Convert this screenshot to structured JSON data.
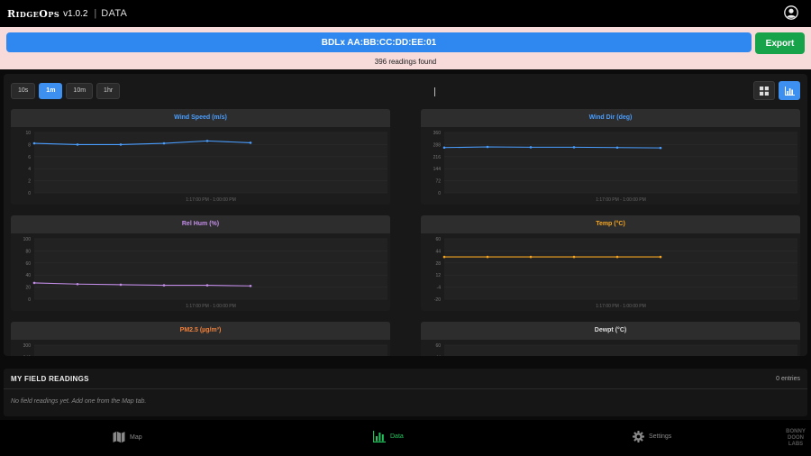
{
  "header": {
    "brand": "RidgeOps",
    "version": "v1.0.2",
    "separator": "|",
    "section": "DATA",
    "user_icon": "user-circle-icon"
  },
  "device": {
    "label": "BDLx AA:BB:CC:DD:EE:01",
    "export_label": "Export",
    "readings_found": "396 readings found"
  },
  "controls": {
    "ranges": [
      {
        "label": "10s",
        "active": false
      },
      {
        "label": "1m",
        "active": true
      },
      {
        "label": "10m",
        "active": false
      },
      {
        "label": "1hr",
        "active": false
      }
    ],
    "views": [
      {
        "icon": "grid-icon",
        "active": false
      },
      {
        "icon": "bar-chart-icon",
        "active": true
      }
    ]
  },
  "colors": {
    "accent": "#3d8ff0",
    "export": "#17a34a",
    "banner_bg": "#f7dada",
    "wind_speed": "#4a9eff",
    "wind_dir": "#4a9eff",
    "rel_hum": "#c38de8",
    "temp": "#f5a623",
    "pm25": "#f0803c",
    "dewpt": "#dddddd"
  },
  "charts": [
    {
      "title": "Wind Speed (m/s)",
      "color_key": "wind_speed",
      "ticks": [
        "10",
        "8",
        "6",
        "4",
        "2",
        "0"
      ],
      "ylim": [
        0,
        10
      ],
      "values": [
        8.2,
        8.0,
        8.0,
        8.2,
        8.6,
        8.3
      ],
      "time_label": "1:17:00 PM - 1:00:00 PM"
    },
    {
      "title": "Wind Dir (deg)",
      "color_key": "wind_dir",
      "ticks": [
        "360",
        "288",
        "216",
        "144",
        "72",
        "0"
      ],
      "ylim": [
        0,
        360
      ],
      "values": [
        270,
        274,
        272,
        272,
        270,
        268
      ],
      "time_label": "1:17:00 PM - 1:00:00 PM"
    },
    {
      "title": "Rel Hum (%)",
      "color_key": "rel_hum",
      "ticks": [
        "100",
        "80",
        "60",
        "40",
        "20",
        "0"
      ],
      "ylim": [
        0,
        100
      ],
      "values": [
        27,
        25,
        24,
        23,
        23,
        22
      ],
      "time_label": "1:17:00 PM - 1:00:00 PM"
    },
    {
      "title": "Temp (°C)",
      "color_key": "temp",
      "ticks": [
        "60",
        "44",
        "28",
        "12",
        "-4",
        "-20"
      ],
      "ylim": [
        -20,
        60
      ],
      "values": [
        36,
        36,
        36,
        36,
        36,
        36
      ],
      "time_label": "1:17:00 PM - 1:00:00 PM"
    },
    {
      "title": "PM2.5 (µg/m³)",
      "color_key": "pm25",
      "ticks": [
        "300",
        "240"
      ],
      "ylim": [
        0,
        300
      ],
      "values": [],
      "time_label": ""
    },
    {
      "title": "Dewpt (°C)",
      "color_key": "dewpt",
      "ticks": [
        "60",
        "44"
      ],
      "ylim": [
        -20,
        60
      ],
      "values": [],
      "time_label": ""
    }
  ],
  "field_readings": {
    "title": "MY FIELD READINGS",
    "count": "0 entries",
    "empty": "No field readings yet. Add one from the Map tab."
  },
  "nav": [
    {
      "label": "Map",
      "icon": "map-icon",
      "active": false
    },
    {
      "label": "Data",
      "icon": "bar-chart-icon",
      "active": true
    },
    {
      "label": "Settings",
      "icon": "gear-icon",
      "active": false
    }
  ],
  "logo": [
    "BONNY",
    "DOON",
    "LABS"
  ]
}
